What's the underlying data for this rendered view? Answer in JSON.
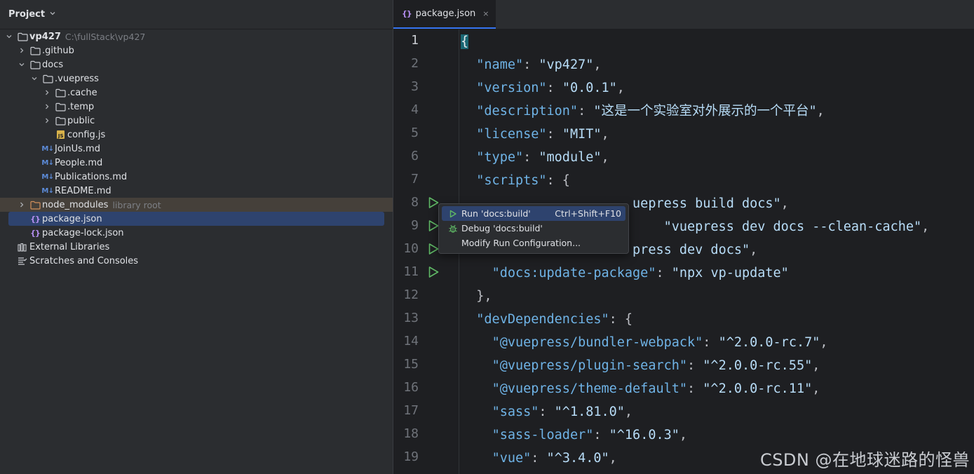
{
  "project": {
    "title": "Project",
    "tree": [
      {
        "label": "vp427",
        "hint": "C:\\fullStack\\vp427",
        "expanded": true,
        "kind": "folder"
      },
      {
        "label": ".github",
        "expanded": false,
        "kind": "folder"
      },
      {
        "label": "docs",
        "expanded": true,
        "kind": "folder"
      },
      {
        "label": ".vuepress",
        "expanded": true,
        "kind": "folder"
      },
      {
        "label": ".cache",
        "expanded": false,
        "kind": "folder"
      },
      {
        "label": ".temp",
        "expanded": false,
        "kind": "folder"
      },
      {
        "label": "public",
        "expanded": false,
        "kind": "folder"
      },
      {
        "label": "config.js",
        "kind": "js"
      },
      {
        "label": "JoinUs.md",
        "kind": "md"
      },
      {
        "label": "People.md",
        "kind": "md"
      },
      {
        "label": "Publications.md",
        "kind": "md"
      },
      {
        "label": "README.md",
        "kind": "md"
      },
      {
        "label": "node_modules",
        "hint": "library root",
        "expanded": false,
        "kind": "folder-excluded"
      },
      {
        "label": "package.json",
        "kind": "json",
        "selected": true
      },
      {
        "label": "package-lock.json",
        "kind": "json"
      },
      {
        "label": "External Libraries",
        "kind": "libraries"
      },
      {
        "label": "Scratches and Consoles",
        "kind": "scratches"
      }
    ]
  },
  "editor": {
    "tab_label": "package.json",
    "tab_close": "×",
    "line_numbers": [
      "1",
      "2",
      "3",
      "4",
      "5",
      "6",
      "7",
      "8",
      "9",
      "10",
      "11",
      "12",
      "13",
      "14",
      "15",
      "16",
      "17",
      "18",
      "19"
    ],
    "lines": [
      [
        {
          "t": "{",
          "c": "brace-hl"
        }
      ],
      [
        {
          "t": "  "
        },
        {
          "t": "\"name\"",
          "c": "k"
        },
        {
          "t": ": "
        },
        {
          "t": "\"vp427\"",
          "c": "s"
        },
        {
          "t": ","
        }
      ],
      [
        {
          "t": "  "
        },
        {
          "t": "\"version\"",
          "c": "k"
        },
        {
          "t": ": "
        },
        {
          "t": "\"0.0.1\"",
          "c": "s"
        },
        {
          "t": ","
        }
      ],
      [
        {
          "t": "  "
        },
        {
          "t": "\"description\"",
          "c": "k"
        },
        {
          "t": ": "
        },
        {
          "t": "\"这是一个实验室对外展示的一个平台\"",
          "c": "s"
        },
        {
          "t": ","
        }
      ],
      [
        {
          "t": "  "
        },
        {
          "t": "\"license\"",
          "c": "k"
        },
        {
          "t": ": "
        },
        {
          "t": "\"MIT\"",
          "c": "s"
        },
        {
          "t": ","
        }
      ],
      [
        {
          "t": "  "
        },
        {
          "t": "\"type\"",
          "c": "k"
        },
        {
          "t": ": "
        },
        {
          "t": "\"module\"",
          "c": "s"
        },
        {
          "t": ","
        }
      ],
      [
        {
          "t": "  "
        },
        {
          "t": "\"scripts\"",
          "c": "k"
        },
        {
          "t": ": {"
        }
      ],
      [
        {
          "t": "                      "
        },
        {
          "t": "uepress build docs\"",
          "c": "s"
        },
        {
          "t": ","
        }
      ],
      [
        {
          "t": "                          "
        },
        {
          "t": "\"vuepress dev docs --clean-cache\"",
          "c": "s"
        },
        {
          "t": ","
        }
      ],
      [
        {
          "t": "                      "
        },
        {
          "t": "press dev docs\"",
          "c": "s"
        },
        {
          "t": ","
        }
      ],
      [
        {
          "t": "    "
        },
        {
          "t": "\"docs:update-package\"",
          "c": "k"
        },
        {
          "t": ": "
        },
        {
          "t": "\"npx vp-update\"",
          "c": "s"
        }
      ],
      [
        {
          "t": "  },"
        }
      ],
      [
        {
          "t": "  "
        },
        {
          "t": "\"devDependencies\"",
          "c": "k"
        },
        {
          "t": ": {"
        }
      ],
      [
        {
          "t": "    "
        },
        {
          "t": "\"@vuepress/bundler-webpack\"",
          "c": "k"
        },
        {
          "t": ": "
        },
        {
          "t": "\"^2.0.0-rc.7\"",
          "c": "s"
        },
        {
          "t": ","
        }
      ],
      [
        {
          "t": "    "
        },
        {
          "t": "\"@vuepress/plugin-search\"",
          "c": "k"
        },
        {
          "t": ": "
        },
        {
          "t": "\"^2.0.0-rc.55\"",
          "c": "s"
        },
        {
          "t": ","
        }
      ],
      [
        {
          "t": "    "
        },
        {
          "t": "\"@vuepress/theme-default\"",
          "c": "k"
        },
        {
          "t": ": "
        },
        {
          "t": "\"^2.0.0-rc.11\"",
          "c": "s"
        },
        {
          "t": ","
        }
      ],
      [
        {
          "t": "    "
        },
        {
          "t": "\"sass\"",
          "c": "k"
        },
        {
          "t": ": "
        },
        {
          "t": "\"^1.81.0\"",
          "c": "s"
        },
        {
          "t": ","
        }
      ],
      [
        {
          "t": "    "
        },
        {
          "t": "\"sass-loader\"",
          "c": "k"
        },
        {
          "t": ": "
        },
        {
          "t": "\"^16.0.3\"",
          "c": "s"
        },
        {
          "t": ","
        }
      ],
      [
        {
          "t": "    "
        },
        {
          "t": "\"vue\"",
          "c": "k"
        },
        {
          "t": ": "
        },
        {
          "t": "\"^3.4.0\"",
          "c": "s"
        },
        {
          "t": ","
        }
      ]
    ],
    "run_lines": [
      8,
      9,
      10,
      11
    ]
  },
  "popup": {
    "run_label": "Run 'docs:build'",
    "run_shortcut": "Ctrl+Shift+F10",
    "debug_label": "Debug 'docs:build'",
    "modify_label": "Modify Run Configuration..."
  },
  "watermark": "CSDN @在地球迷路的怪兽",
  "colors": {
    "key": "#6fb3e6",
    "string": "#b7dcf7",
    "selection": "#2e436e",
    "run_icon": "#5fb865"
  }
}
